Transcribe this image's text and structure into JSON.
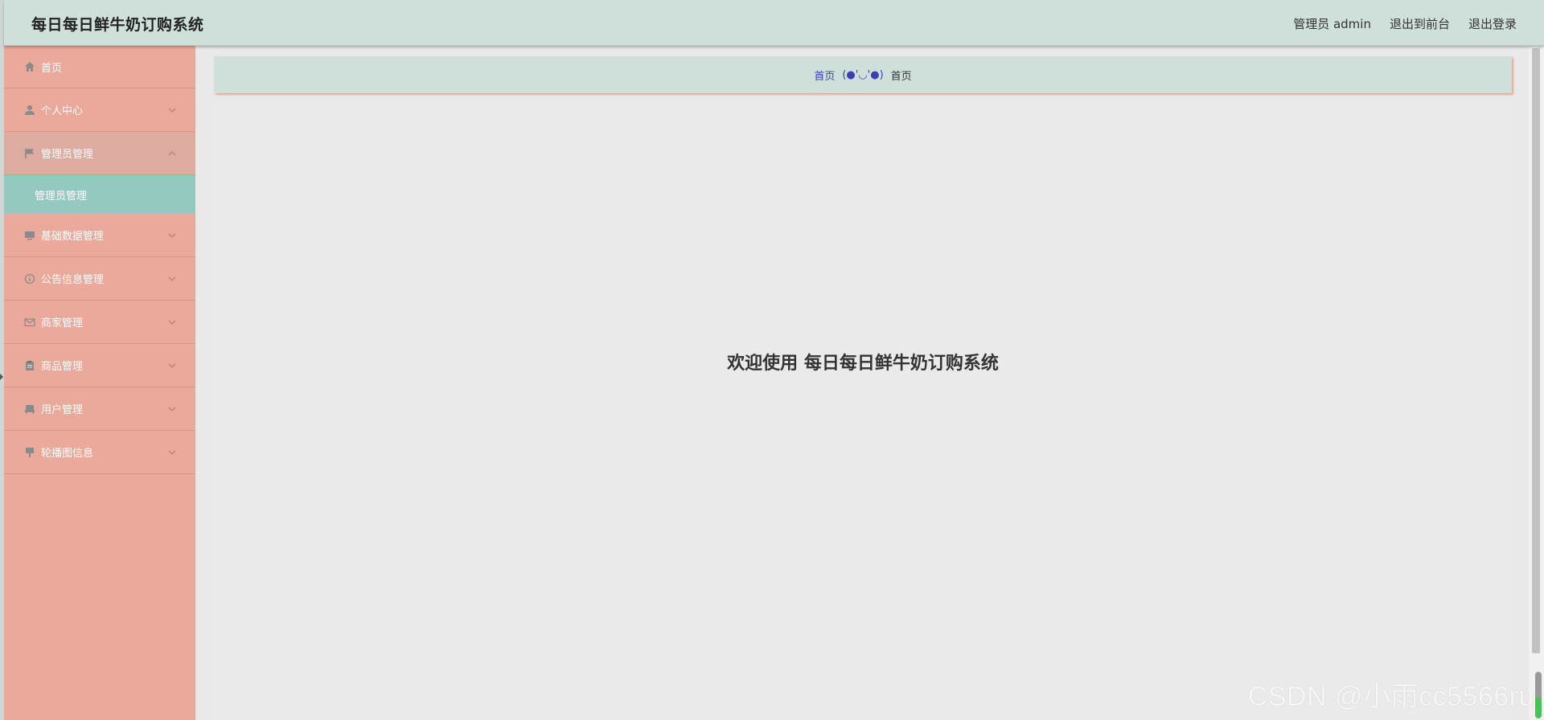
{
  "header": {
    "title": "每日每日鲜牛奶订购系统",
    "user_label": "管理员 admin",
    "to_frontend": "退出到前台",
    "logout": "退出登录"
  },
  "sidebar": {
    "items": [
      {
        "label": "首页",
        "icon": "home-icon"
      },
      {
        "label": "个人中心",
        "icon": "user-icon"
      },
      {
        "label": "管理员管理",
        "icon": "flag-icon",
        "expanded": true,
        "children": [
          {
            "label": "管理员管理"
          }
        ]
      },
      {
        "label": "基础数据管理",
        "icon": "monitor-icon"
      },
      {
        "label": "公告信息管理",
        "icon": "info-icon"
      },
      {
        "label": "商家管理",
        "icon": "mail-icon"
      },
      {
        "label": "商品管理",
        "icon": "clipboard-icon"
      },
      {
        "label": "用户管理",
        "icon": "seat-icon"
      },
      {
        "label": "轮播图信息",
        "icon": "pin-icon"
      }
    ]
  },
  "breadcrumb": {
    "home": "首页",
    "separator": "(●'◡'●)",
    "current": "首页"
  },
  "main": {
    "welcome": "欢迎使用 每日每日鲜牛奶订购系统"
  },
  "watermark": "CSDN @小雨cc5566ru",
  "colors": {
    "header_bg": "#cfe0da",
    "sidebar_bg": "#eaa99b",
    "submenu_active_bg": "#94c9c0",
    "content_bg": "#e9e9e9",
    "breadcrumb_link": "#3b3fb6"
  }
}
